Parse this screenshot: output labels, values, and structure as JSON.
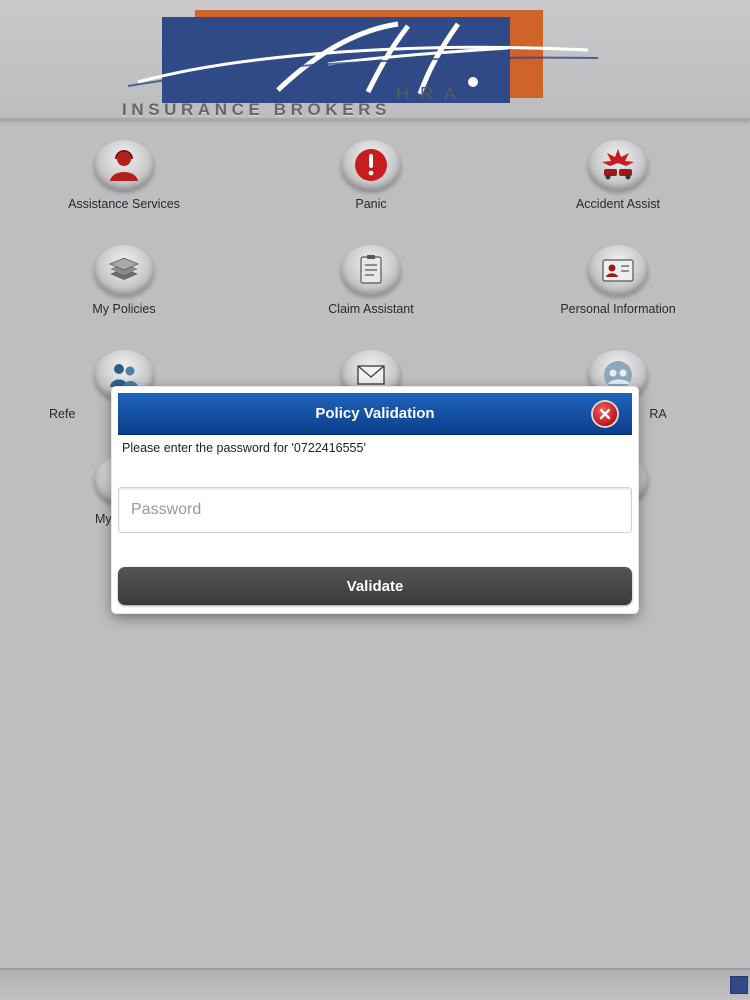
{
  "header": {
    "logo_initials": "HRA",
    "logo_tagline": "INSURANCE BROKERS"
  },
  "tiles": [
    {
      "label": "Assistance Services",
      "icon": "assistance-icon"
    },
    {
      "label": "Panic",
      "icon": "panic-icon"
    },
    {
      "label": "Accident Assist",
      "icon": "accident-icon"
    },
    {
      "label": "My Policies",
      "icon": "policies-icon"
    },
    {
      "label": "Claim Assistant",
      "icon": "claim-icon"
    },
    {
      "label": "Personal Information",
      "icon": "personal-info-icon"
    },
    {
      "label": "Refe",
      "icon": "referral-icon"
    },
    {
      "label": "",
      "icon": "mail-icon"
    },
    {
      "label": "RA",
      "icon": "about-hra-icon"
    },
    {
      "label": "My",
      "icon": "my-icon"
    },
    {
      "label": "",
      "icon": "hidden-icon"
    },
    {
      "label": "",
      "icon": "hidden-icon"
    }
  ],
  "modal": {
    "title": "Policy Validation",
    "message": "Please enter the password for '0722416555'",
    "password_placeholder": "Password",
    "password_value": "",
    "validate_label": "Validate"
  },
  "colors": {
    "background": "#bebdbf",
    "modal_header": "#1f63bb",
    "validate_button": "#4a4a4c",
    "close_button": "#c11616",
    "logo_blue": "#2f4a86",
    "logo_orange": "#d0632a"
  }
}
